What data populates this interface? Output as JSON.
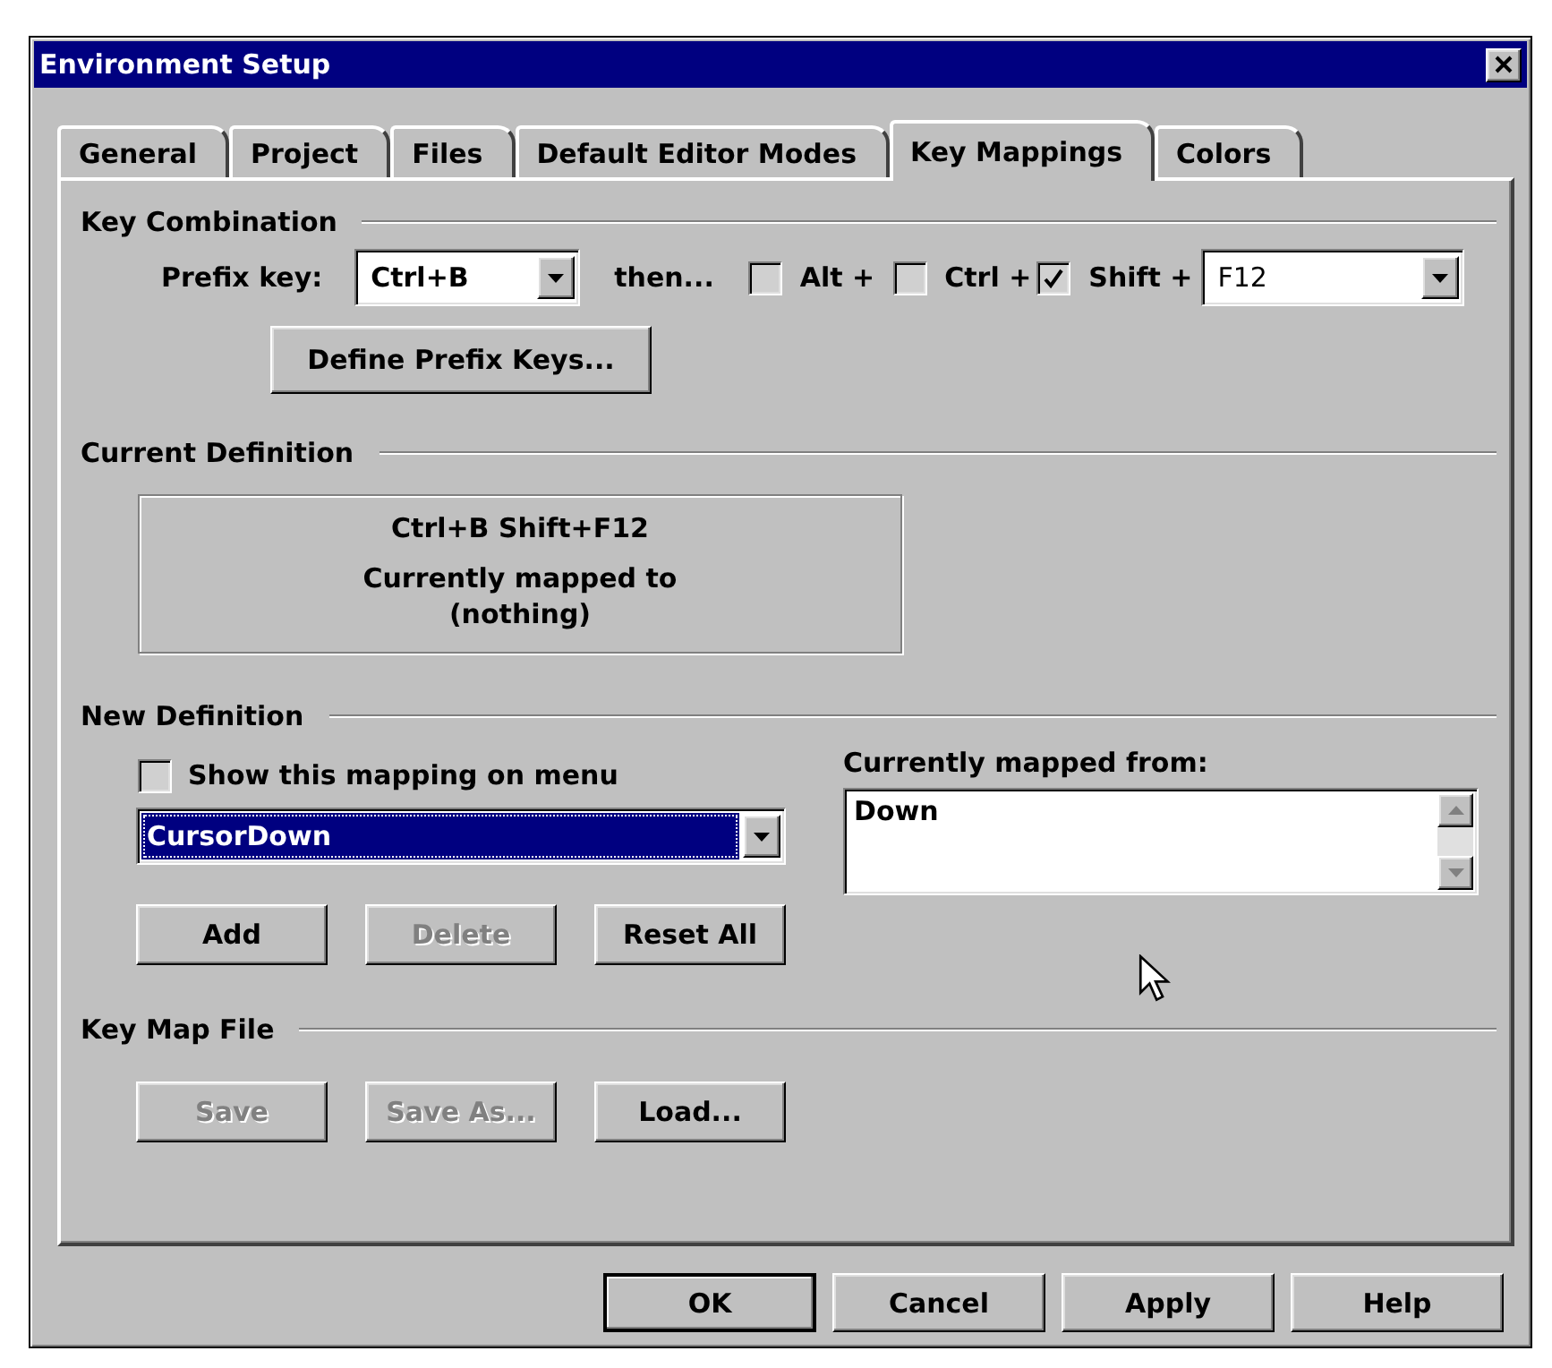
{
  "window": {
    "title": "Environment Setup"
  },
  "tabs": [
    {
      "label": "General",
      "selected": false
    },
    {
      "label": "Project",
      "selected": false
    },
    {
      "label": "Files",
      "selected": false
    },
    {
      "label": "Default Editor Modes",
      "selected": false
    },
    {
      "label": "Key Mappings",
      "selected": true
    },
    {
      "label": "Colors",
      "selected": false
    }
  ],
  "key_combination": {
    "heading": "Key Combination",
    "prefix_key": {
      "label": "Prefix key:",
      "value": "Ctrl+B"
    },
    "then_label": "then...",
    "modifiers": [
      {
        "label": "Alt +",
        "checked": false
      },
      {
        "label": "Ctrl +",
        "checked": false
      },
      {
        "label": "Shift +",
        "checked": true
      }
    ],
    "key": {
      "value": "F12"
    },
    "define_button": {
      "label": "Define Prefix Keys..."
    }
  },
  "current_definition": {
    "heading": "Current Definition",
    "lines": [
      "Ctrl+B Shift+F12",
      "Currently mapped to",
      "(nothing)"
    ]
  },
  "new_definition": {
    "heading": "New Definition",
    "show_on_menu": {
      "label": "Show this mapping on menu",
      "checked": false
    },
    "command": {
      "value": "CursorDown",
      "selected": true
    },
    "mapped_from": {
      "label": "Currently mapped from:",
      "items": [
        "Down"
      ]
    },
    "buttons": [
      {
        "label": "Add",
        "disabled": false
      },
      {
        "label": "Delete",
        "disabled": true
      },
      {
        "label": "Reset All",
        "disabled": false
      }
    ]
  },
  "key_map_file": {
    "heading": "Key Map File",
    "buttons": [
      {
        "label": "Save",
        "disabled": true
      },
      {
        "label": "Save As...",
        "disabled": true
      },
      {
        "label": "Load...",
        "disabled": false
      }
    ]
  },
  "dialog_buttons": [
    {
      "label": "OK",
      "default": true
    },
    {
      "label": "Cancel",
      "default": false
    },
    {
      "label": "Apply",
      "default": false
    },
    {
      "label": "Help",
      "default": false
    }
  ]
}
